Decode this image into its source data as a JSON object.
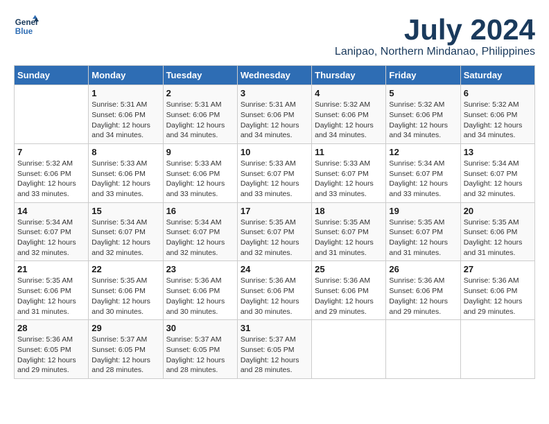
{
  "header": {
    "logo_line1": "General",
    "logo_line2": "Blue",
    "month_year": "July 2024",
    "location": "Lanipao, Northern Mindanao, Philippines"
  },
  "days_of_week": [
    "Sunday",
    "Monday",
    "Tuesday",
    "Wednesday",
    "Thursday",
    "Friday",
    "Saturday"
  ],
  "weeks": [
    [
      {
        "day": "",
        "info": ""
      },
      {
        "day": "1",
        "info": "Sunrise: 5:31 AM\nSunset: 6:06 PM\nDaylight: 12 hours\nand 34 minutes."
      },
      {
        "day": "2",
        "info": "Sunrise: 5:31 AM\nSunset: 6:06 PM\nDaylight: 12 hours\nand 34 minutes."
      },
      {
        "day": "3",
        "info": "Sunrise: 5:31 AM\nSunset: 6:06 PM\nDaylight: 12 hours\nand 34 minutes."
      },
      {
        "day": "4",
        "info": "Sunrise: 5:32 AM\nSunset: 6:06 PM\nDaylight: 12 hours\nand 34 minutes."
      },
      {
        "day": "5",
        "info": "Sunrise: 5:32 AM\nSunset: 6:06 PM\nDaylight: 12 hours\nand 34 minutes."
      },
      {
        "day": "6",
        "info": "Sunrise: 5:32 AM\nSunset: 6:06 PM\nDaylight: 12 hours\nand 34 minutes."
      }
    ],
    [
      {
        "day": "7",
        "info": "Sunrise: 5:32 AM\nSunset: 6:06 PM\nDaylight: 12 hours\nand 33 minutes."
      },
      {
        "day": "8",
        "info": "Sunrise: 5:33 AM\nSunset: 6:06 PM\nDaylight: 12 hours\nand 33 minutes."
      },
      {
        "day": "9",
        "info": "Sunrise: 5:33 AM\nSunset: 6:06 PM\nDaylight: 12 hours\nand 33 minutes."
      },
      {
        "day": "10",
        "info": "Sunrise: 5:33 AM\nSunset: 6:07 PM\nDaylight: 12 hours\nand 33 minutes."
      },
      {
        "day": "11",
        "info": "Sunrise: 5:33 AM\nSunset: 6:07 PM\nDaylight: 12 hours\nand 33 minutes."
      },
      {
        "day": "12",
        "info": "Sunrise: 5:34 AM\nSunset: 6:07 PM\nDaylight: 12 hours\nand 33 minutes."
      },
      {
        "day": "13",
        "info": "Sunrise: 5:34 AM\nSunset: 6:07 PM\nDaylight: 12 hours\nand 32 minutes."
      }
    ],
    [
      {
        "day": "14",
        "info": "Sunrise: 5:34 AM\nSunset: 6:07 PM\nDaylight: 12 hours\nand 32 minutes."
      },
      {
        "day": "15",
        "info": "Sunrise: 5:34 AM\nSunset: 6:07 PM\nDaylight: 12 hours\nand 32 minutes."
      },
      {
        "day": "16",
        "info": "Sunrise: 5:34 AM\nSunset: 6:07 PM\nDaylight: 12 hours\nand 32 minutes."
      },
      {
        "day": "17",
        "info": "Sunrise: 5:35 AM\nSunset: 6:07 PM\nDaylight: 12 hours\nand 32 minutes."
      },
      {
        "day": "18",
        "info": "Sunrise: 5:35 AM\nSunset: 6:07 PM\nDaylight: 12 hours\nand 31 minutes."
      },
      {
        "day": "19",
        "info": "Sunrise: 5:35 AM\nSunset: 6:07 PM\nDaylight: 12 hours\nand 31 minutes."
      },
      {
        "day": "20",
        "info": "Sunrise: 5:35 AM\nSunset: 6:06 PM\nDaylight: 12 hours\nand 31 minutes."
      }
    ],
    [
      {
        "day": "21",
        "info": "Sunrise: 5:35 AM\nSunset: 6:06 PM\nDaylight: 12 hours\nand 31 minutes."
      },
      {
        "day": "22",
        "info": "Sunrise: 5:35 AM\nSunset: 6:06 PM\nDaylight: 12 hours\nand 30 minutes."
      },
      {
        "day": "23",
        "info": "Sunrise: 5:36 AM\nSunset: 6:06 PM\nDaylight: 12 hours\nand 30 minutes."
      },
      {
        "day": "24",
        "info": "Sunrise: 5:36 AM\nSunset: 6:06 PM\nDaylight: 12 hours\nand 30 minutes."
      },
      {
        "day": "25",
        "info": "Sunrise: 5:36 AM\nSunset: 6:06 PM\nDaylight: 12 hours\nand 29 minutes."
      },
      {
        "day": "26",
        "info": "Sunrise: 5:36 AM\nSunset: 6:06 PM\nDaylight: 12 hours\nand 29 minutes."
      },
      {
        "day": "27",
        "info": "Sunrise: 5:36 AM\nSunset: 6:06 PM\nDaylight: 12 hours\nand 29 minutes."
      }
    ],
    [
      {
        "day": "28",
        "info": "Sunrise: 5:36 AM\nSunset: 6:05 PM\nDaylight: 12 hours\nand 29 minutes."
      },
      {
        "day": "29",
        "info": "Sunrise: 5:37 AM\nSunset: 6:05 PM\nDaylight: 12 hours\nand 28 minutes."
      },
      {
        "day": "30",
        "info": "Sunrise: 5:37 AM\nSunset: 6:05 PM\nDaylight: 12 hours\nand 28 minutes."
      },
      {
        "day": "31",
        "info": "Sunrise: 5:37 AM\nSunset: 6:05 PM\nDaylight: 12 hours\nand 28 minutes."
      },
      {
        "day": "",
        "info": ""
      },
      {
        "day": "",
        "info": ""
      },
      {
        "day": "",
        "info": ""
      }
    ]
  ]
}
